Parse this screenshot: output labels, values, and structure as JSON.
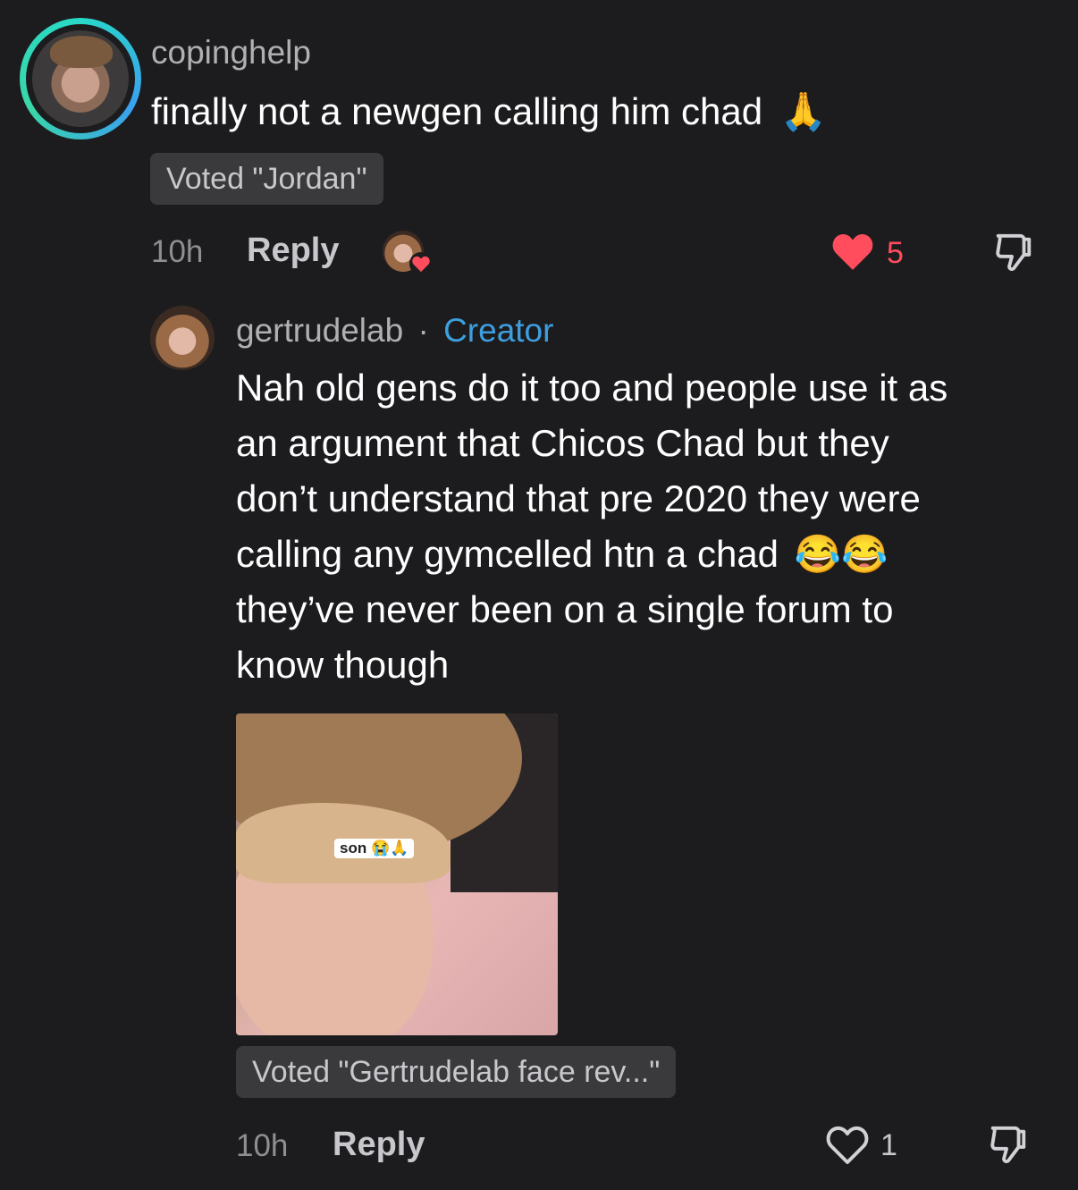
{
  "comment": {
    "username": "copinghelp",
    "text": "finally not a newgen calling him chad",
    "emoji": "🙏",
    "vote": "Voted \"Jordan\"",
    "time": "10h",
    "reply_label": "Reply",
    "likes": "5"
  },
  "reply": {
    "username": "gertrudelab",
    "separator": "·",
    "badge": "Creator",
    "lines": [
      "Nah old gens do it too and people use it as",
      "an argument that Chicos Chad but they",
      "don’t understand that pre 2020 they were",
      "calling any gymcelled htn a chad",
      "they’ve never been on a single forum to",
      "know though"
    ],
    "emojis": "😂😂",
    "media_caption": "son 😭🙏",
    "vote": "Voted \"Gertrudelab face rev...\"",
    "time": "10h",
    "reply_label": "Reply",
    "likes": "1"
  },
  "colors": {
    "background": "#1c1c1e",
    "like_red": "#ff4d5e",
    "creator_blue": "#3d9fe0"
  }
}
